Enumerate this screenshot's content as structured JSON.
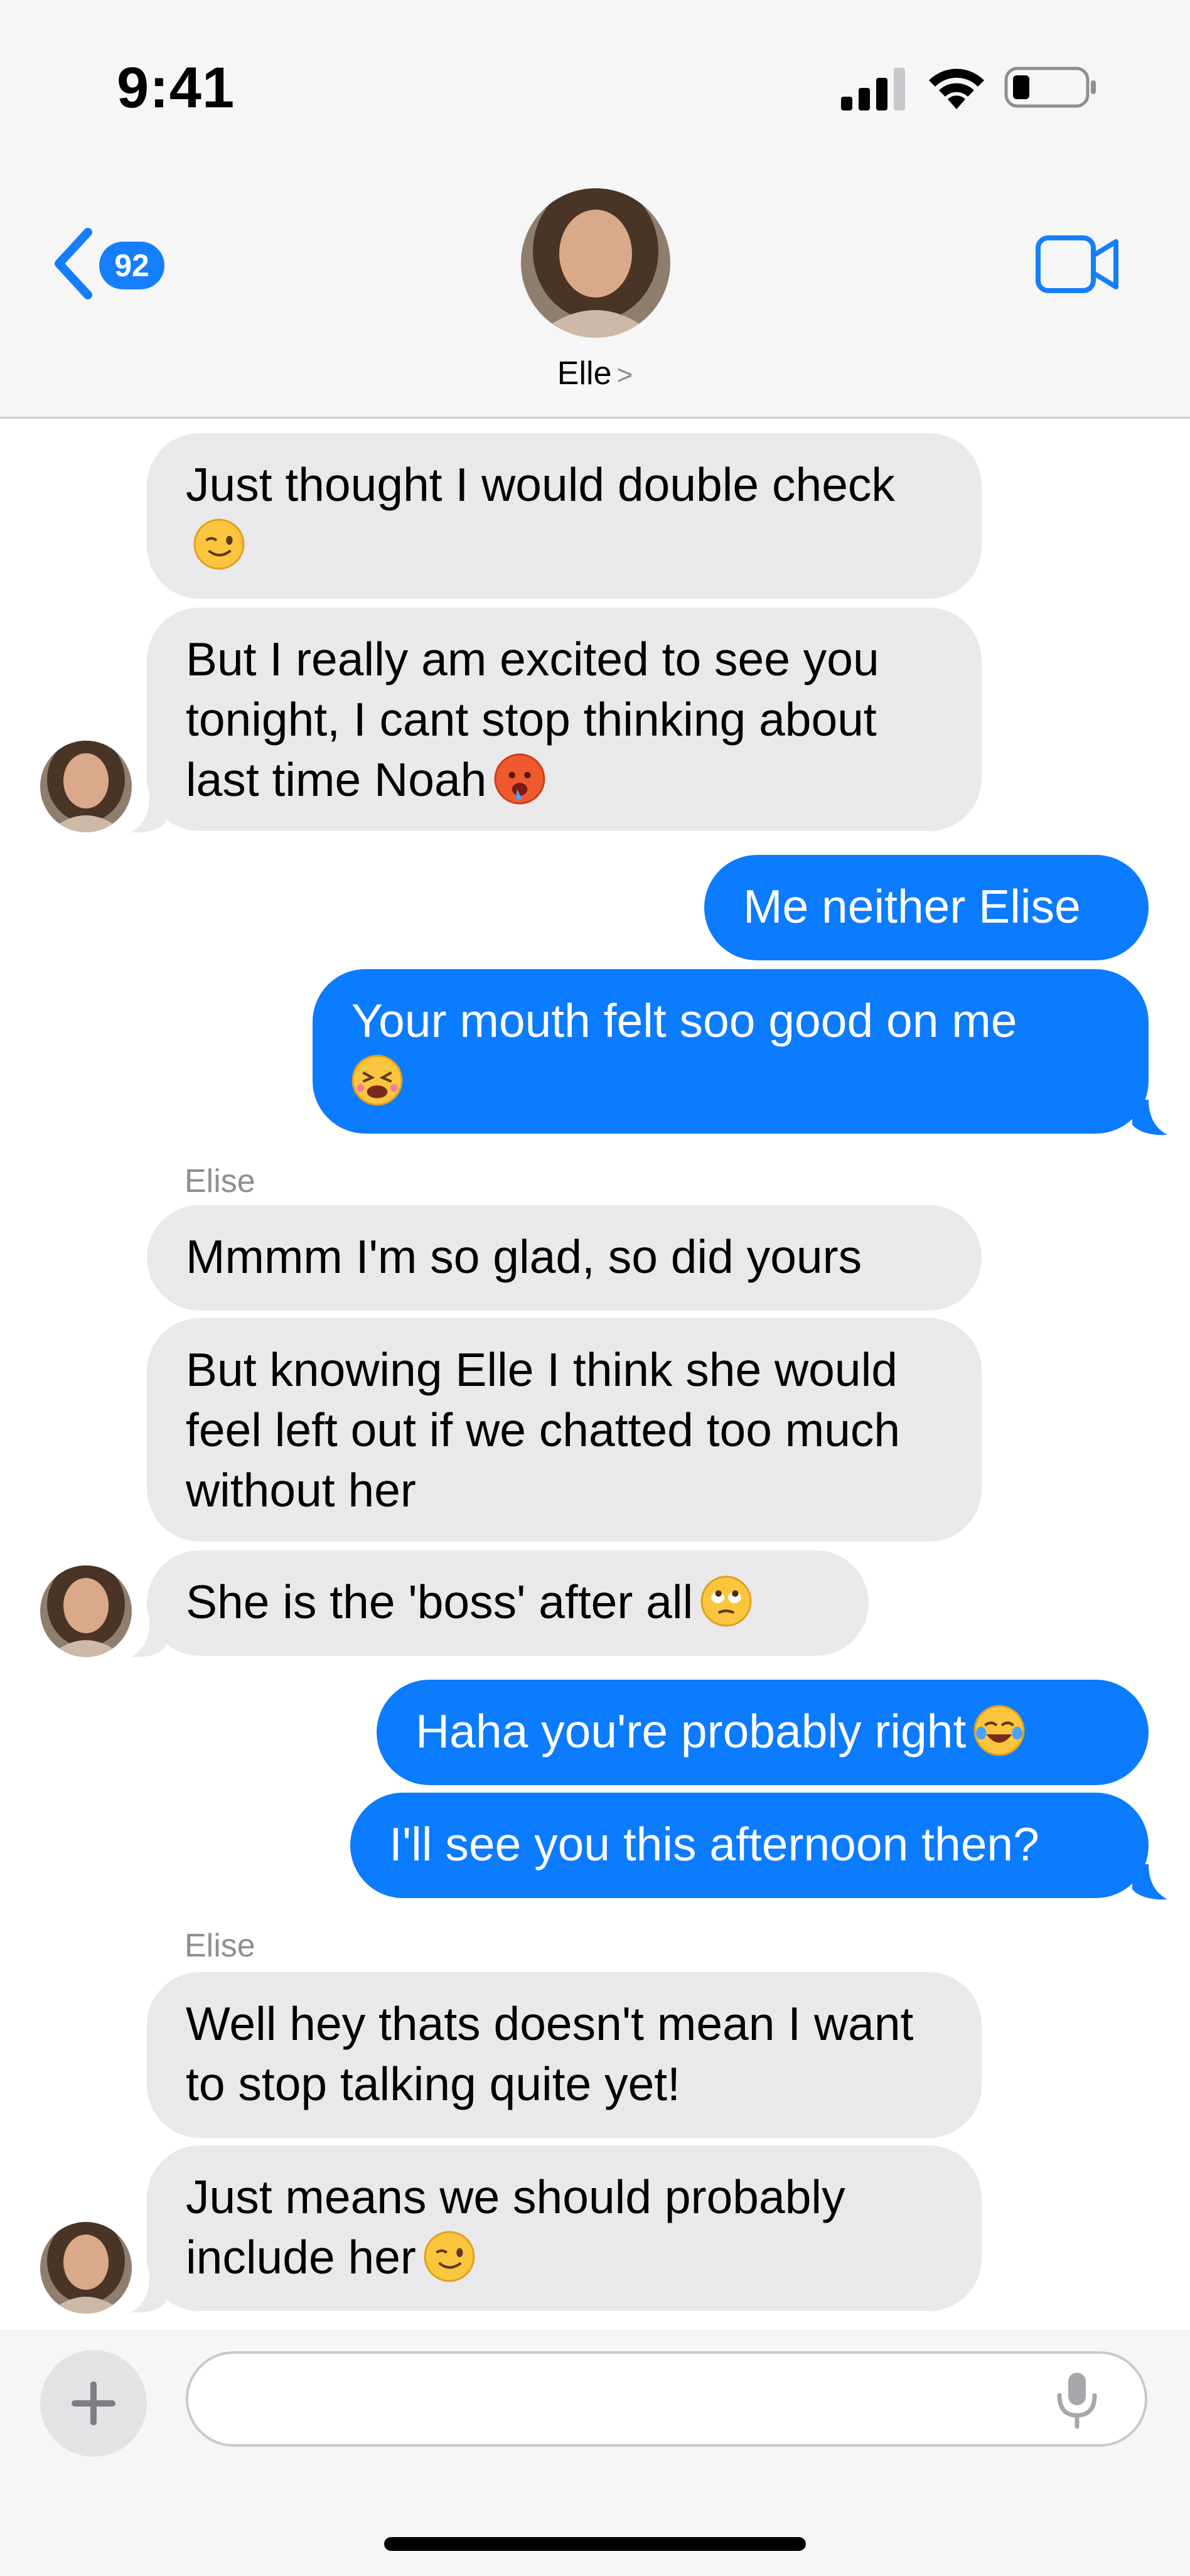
{
  "status_bar": {
    "time": "9:41"
  },
  "nav": {
    "back_badge": "92",
    "contact_name": "Elle",
    "contact_chevron": ">",
    "icons": {
      "back": "chevron-left-icon",
      "video": "video-camera-icon"
    }
  },
  "messages": [
    {
      "dir": "in",
      "text": "Just thought I would double check",
      "emoji": "winking-face"
    },
    {
      "dir": "in",
      "text": "But I really am excited to see you tonight, I cant stop thinking about last time Noah",
      "emoji": "hot-face"
    },
    {
      "dir": "out",
      "text": "Me neither Elise"
    },
    {
      "dir": "out",
      "text": "Your mouth felt soo good on me",
      "emoji": "tired-face"
    },
    {
      "sender": "Elise"
    },
    {
      "dir": "in",
      "text": "Mmmm I'm so glad, so did yours"
    },
    {
      "dir": "in",
      "text": "But knowing Elle I think she would feel left out if we chatted too much without her"
    },
    {
      "dir": "in",
      "text": "She is the 'boss' after all",
      "emoji": "rolling-eyes-face"
    },
    {
      "dir": "out",
      "text": "Haha you're probably right",
      "emoji": "tears-of-joy-face"
    },
    {
      "dir": "out",
      "text": "I'll see you this afternoon then?"
    },
    {
      "sender": "Elise"
    },
    {
      "dir": "in",
      "text": "Well hey thats doesn't mean I want to stop talking quite yet!"
    },
    {
      "dir": "in",
      "text": "Just means we should probably include her",
      "emoji": "winking-face"
    }
  ],
  "composer": {
    "plus": "+",
    "icons": {
      "plus": "plus-icon",
      "mic": "microphone-icon"
    }
  },
  "colors": {
    "outgoing": "#0b7bff",
    "incoming": "#e9e9eb",
    "accent": "#157efb"
  }
}
